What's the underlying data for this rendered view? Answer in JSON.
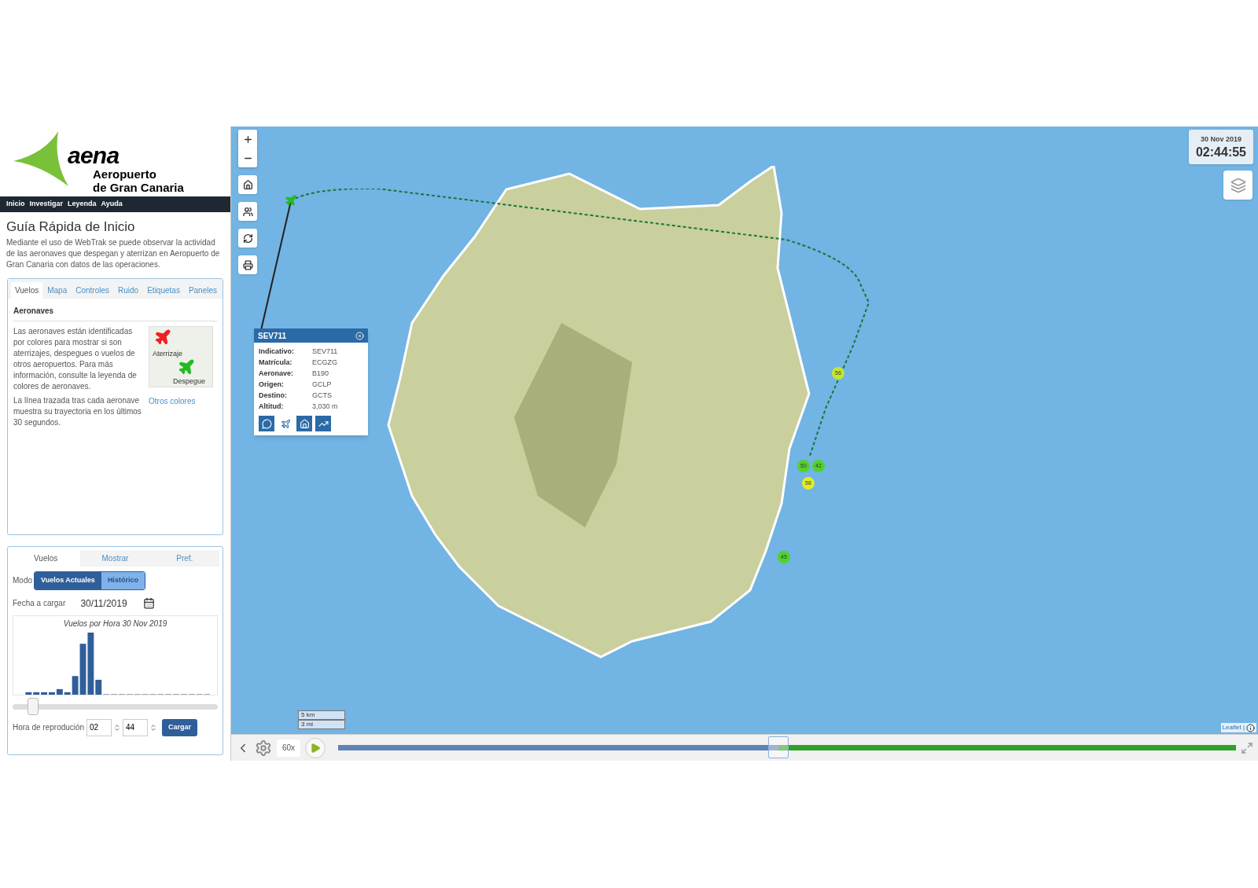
{
  "header": {
    "logo_text": "aena",
    "subtitle": [
      "Aeropuerto",
      "de Gran Canaria"
    ]
  },
  "nav": [
    {
      "label": "Inicio"
    },
    {
      "label": "Investigar"
    },
    {
      "label": "Leyenda"
    },
    {
      "label": "Ayuda"
    }
  ],
  "guide": {
    "title": "Guía Rápida de Inicio",
    "description": "Mediante el uso de WebTrak se puede observar la actividad de las aeronaves que despegan y aterrizan en Aeropuerto de Gran Canaria con datos de las operaciones."
  },
  "info_tabs": [
    {
      "label": "Vuelos",
      "selected": true
    },
    {
      "label": "Mapa",
      "selected": false
    },
    {
      "label": "Controles",
      "selected": false
    },
    {
      "label": "Ruido",
      "selected": false
    },
    {
      "label": "Etiquetas",
      "selected": false
    },
    {
      "label": "Paneles",
      "selected": false
    }
  ],
  "aircraft_section": {
    "heading": "Aeronaves",
    "paragraphs": [
      "Las aeronaves están identificadas por colores para mostrar si son aterrizajes, despegues o vuelos de otros aeropuertos. Para más información, consulte la leyenda de colores de aeronaves.",
      "La línea trazada tras cada aeronave muestra su trayectoria en los últimos 30 segundos."
    ],
    "legend": {
      "landing": "Aterrizaje",
      "takeoff": "Despegue"
    },
    "link": "Otros colores"
  },
  "flights_panel": {
    "tabs": [
      {
        "label": "Vuelos",
        "selected": true
      },
      {
        "label": "Mostrar",
        "selected": false
      },
      {
        "label": "Pref.",
        "selected": false
      }
    ],
    "mode_label": "Modo",
    "modes": [
      {
        "label": "Vuelos Actuales",
        "selected": true
      },
      {
        "label": "Histórico",
        "selected": false
      }
    ],
    "date_label": "Fecha a cargar",
    "date_value": "30/11/2019",
    "chart_title": "Vuelos por Hora 30 Nov 2019",
    "slider": {
      "level": 0.1
    },
    "time_label": "Hora de reprodución",
    "hour": "02",
    "minute": "44",
    "load_button": "Cargar"
  },
  "map": {
    "date": "30 Nov 2019",
    "time": "02:44:55",
    "popup": {
      "title": "SEV711",
      "fields": [
        {
          "label": "Indicativo:",
          "value": "SEV711"
        },
        {
          "label": "Matrícula:",
          "value": "ECGZG"
        },
        {
          "label": "Aeronave:",
          "value": "B190"
        },
        {
          "label": "Origen:",
          "value": "GCLP"
        },
        {
          "label": "Destino:",
          "value": "GCTS"
        },
        {
          "label": "Altitud:",
          "value": "3,030 m"
        }
      ]
    },
    "noise_monitors": [
      {
        "label": "56",
        "color": "#c4e62c"
      },
      {
        "label": "50",
        "color": "#52d12e"
      },
      {
        "label": "42",
        "color": "#52d12e"
      },
      {
        "label": "58",
        "color": "#e2ee22"
      },
      {
        "label": "45",
        "color": "#52d12e"
      }
    ],
    "scale": [
      "5 km",
      "3 mi"
    ],
    "attribution": "Leaflet |"
  },
  "playback": {
    "speed": "60x",
    "level": 0.49
  }
}
